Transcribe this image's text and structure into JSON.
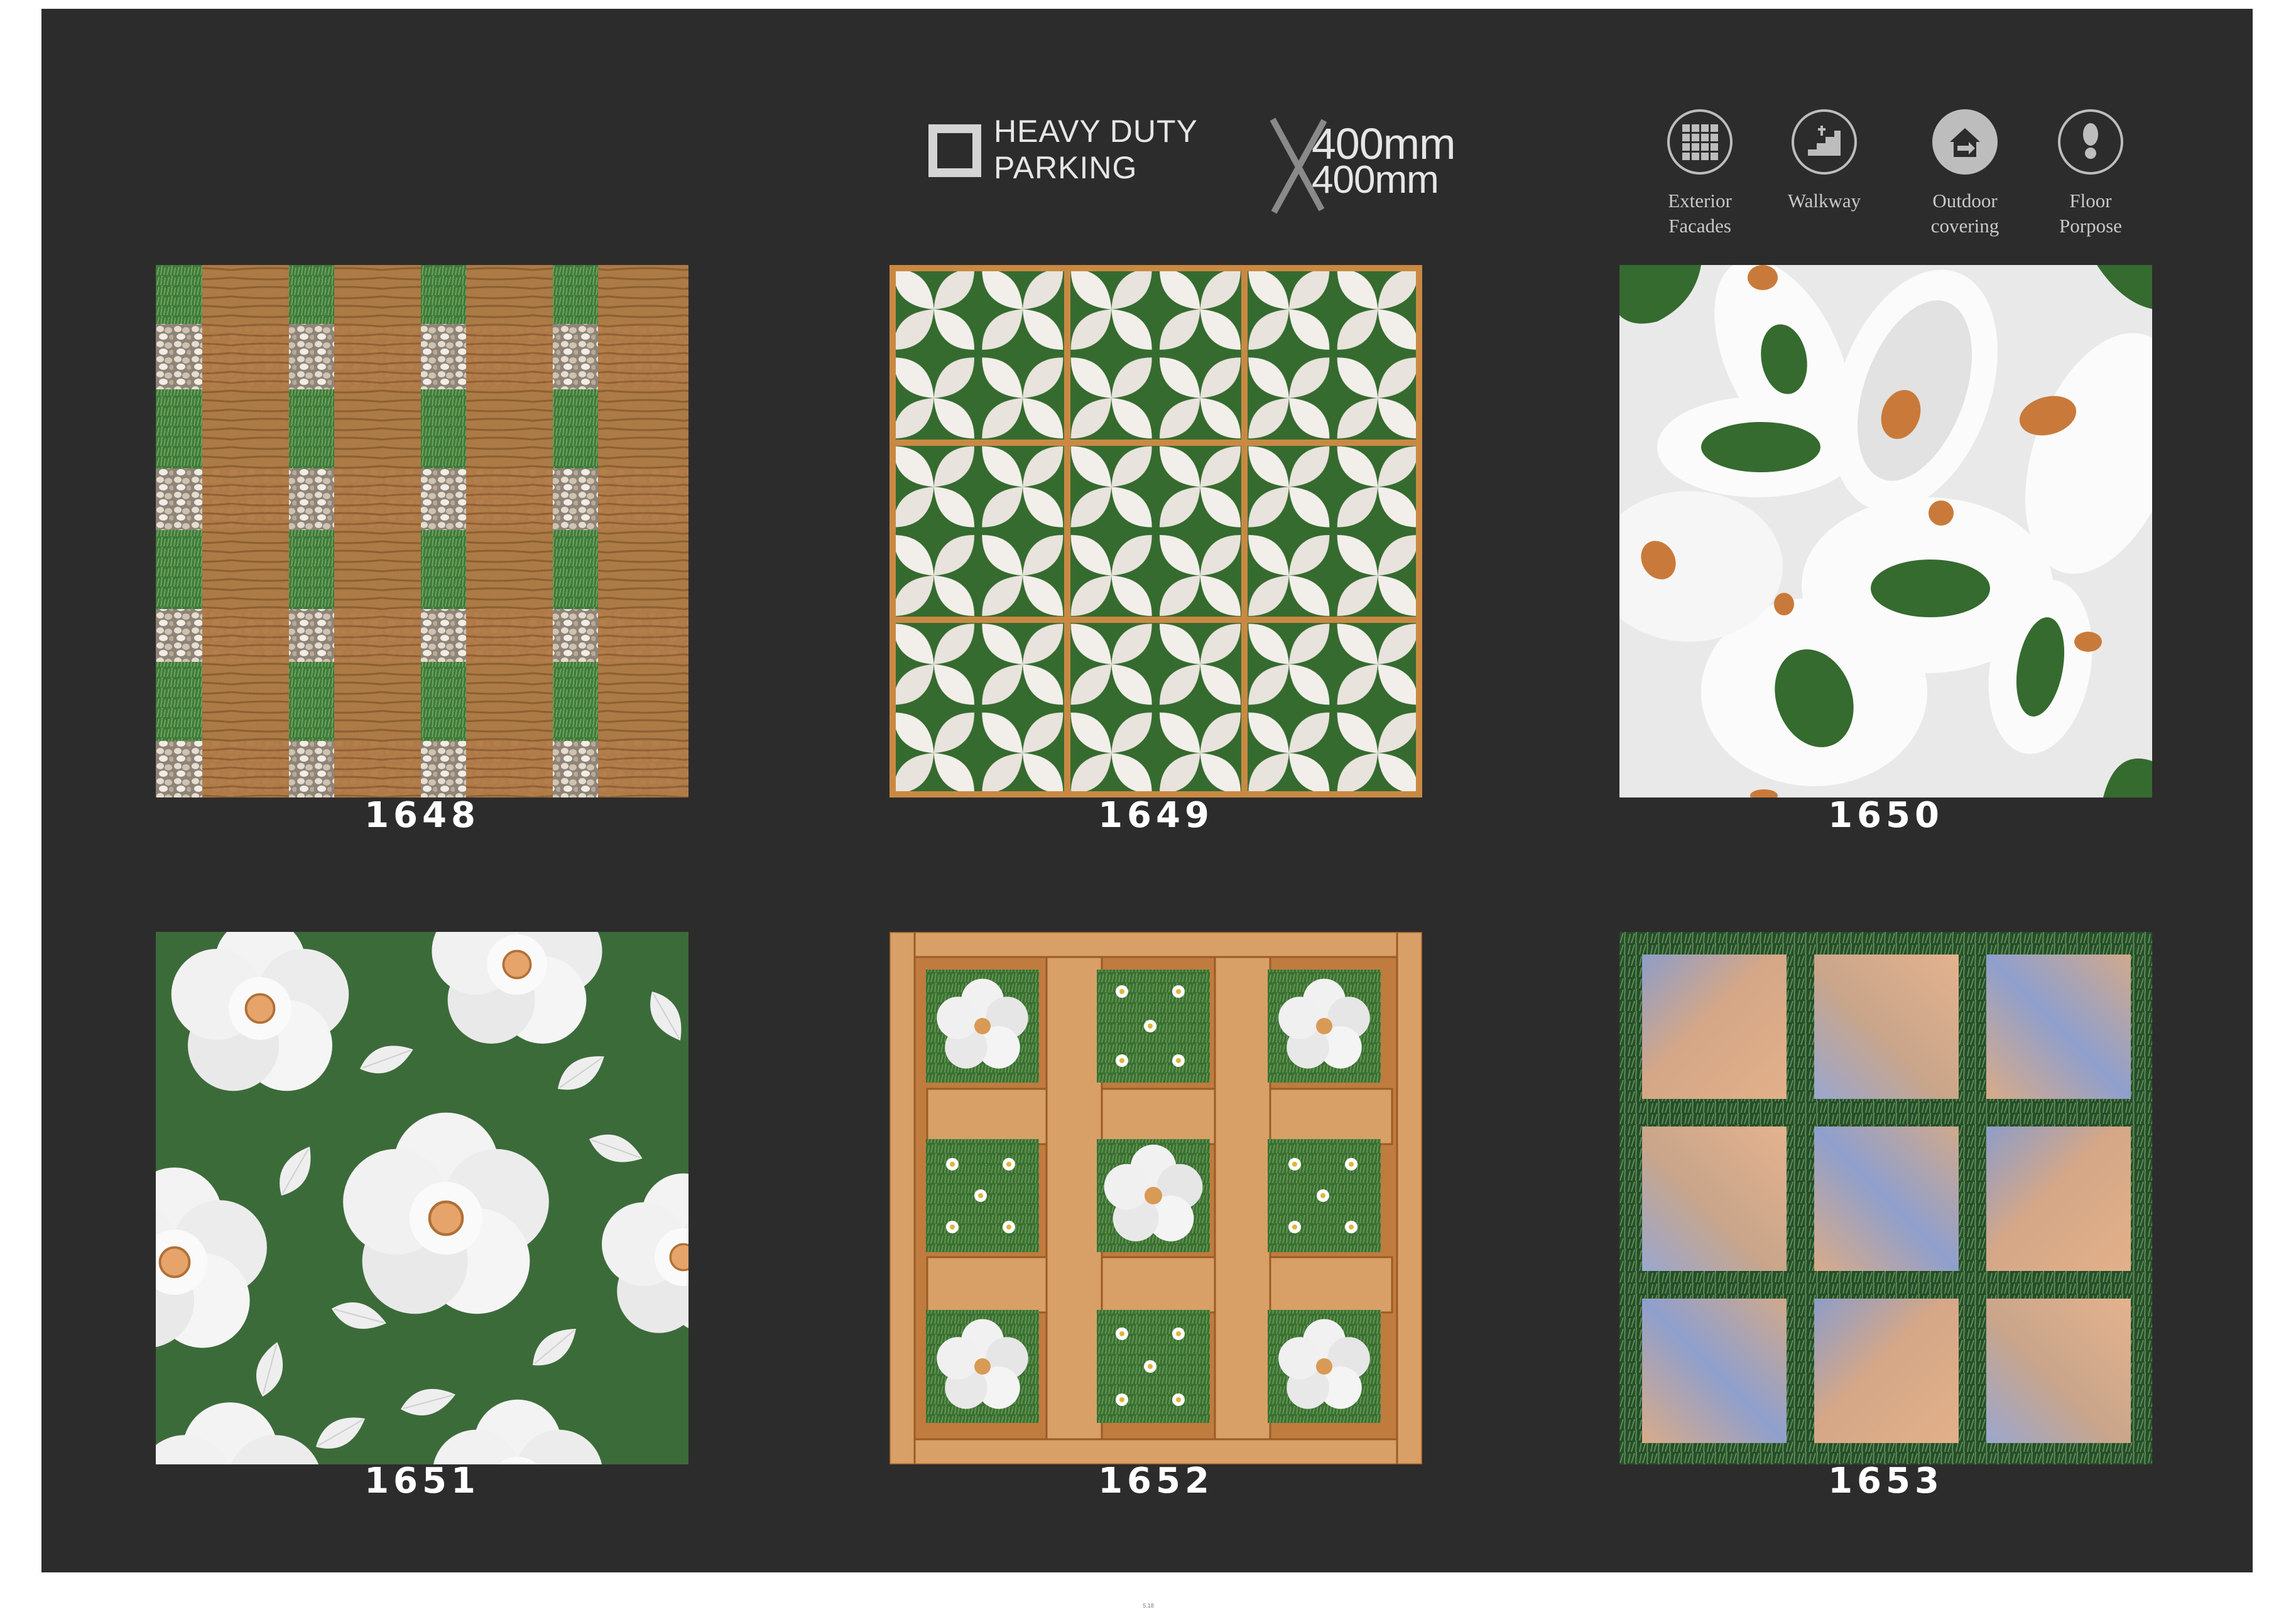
{
  "header": {
    "rating_line1": "HEAVY DUTY",
    "rating_line2": "PARKING",
    "size_line1": "400mm",
    "size_line2": "400mm"
  },
  "applications": [
    {
      "label": "Exterior\nFacades",
      "icon": "tile-grid-icon"
    },
    {
      "label": "Walkway",
      "icon": "stairs-icon"
    },
    {
      "label": "Outdoor\ncovering",
      "icon": "house-icon"
    },
    {
      "label": "Floor\nPorpose",
      "icon": "footprint-icon"
    }
  ],
  "tiles": [
    {
      "code": "1648",
      "pattern": "grass-wood-lattice"
    },
    {
      "code": "1649",
      "pattern": "white-petal-green-grid"
    },
    {
      "code": "1650",
      "pattern": "white-ovals-green-orange"
    },
    {
      "code": "1651",
      "pattern": "white-flowers-on-green"
    },
    {
      "code": "1652",
      "pattern": "wood-frame-grass-daisies"
    },
    {
      "code": "1653",
      "pattern": "stone-squares-grass-border"
    }
  ],
  "colors": {
    "background": "#2d2c2c",
    "grass": "#3f7a3a",
    "wood": "#b07a45",
    "petal": "#f2efea",
    "accent_orange": "#c97a3a"
  },
  "page_number": "5.18"
}
